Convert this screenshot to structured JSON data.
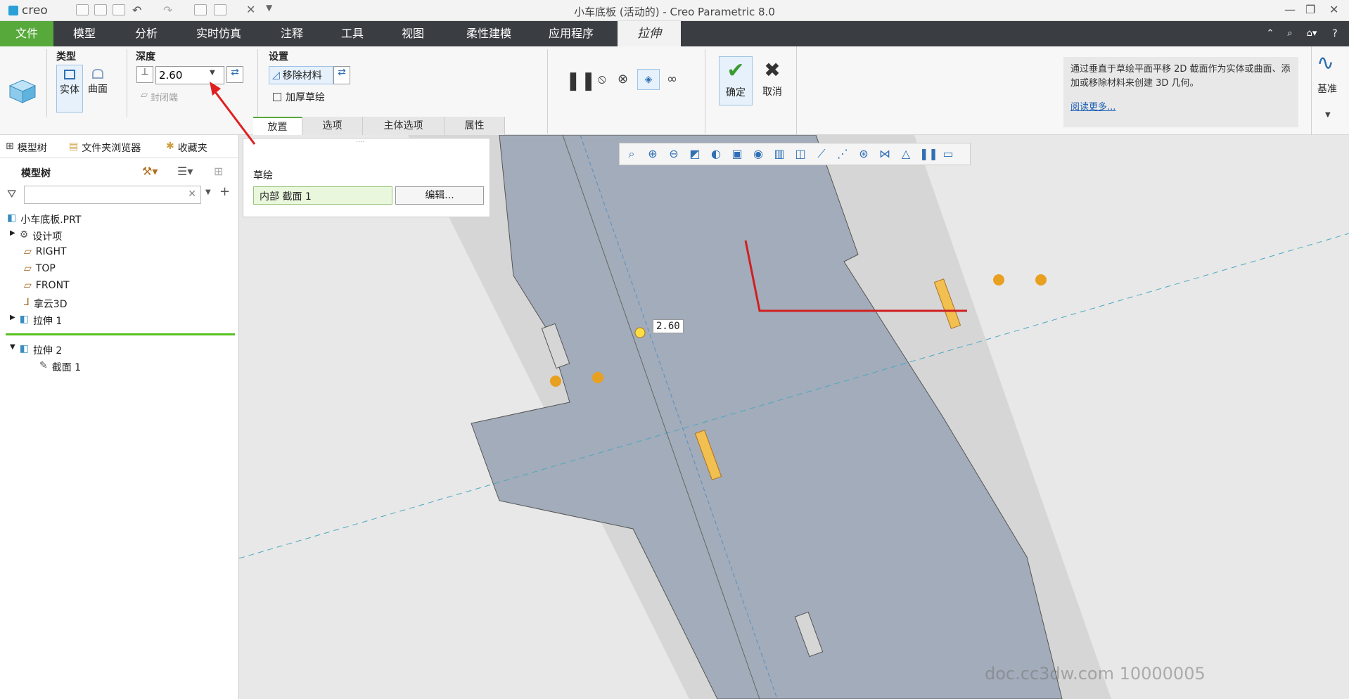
{
  "app": {
    "logo": "creo",
    "title": "小车底板 (活动的) - Creo Parametric 8.0"
  },
  "menu": {
    "file": "文件",
    "items": [
      "模型",
      "分析",
      "实时仿真",
      "注释",
      "工具",
      "视图",
      "柔性建模",
      "应用程序"
    ],
    "active": "拉伸"
  },
  "ribbon": {
    "type_group": "类型",
    "solid": "实体",
    "surface": "曲面",
    "depth_group": "深度",
    "depth_value": "2.60",
    "cap_ends": "封闭端",
    "settings_group": "设置",
    "remove_material": "移除材料",
    "thicken_sketch": "加厚草绘",
    "confirm": "确定",
    "cancel": "取消",
    "tabs": [
      "放置",
      "选项",
      "主体选项",
      "属性"
    ],
    "info_text": "通过垂直于草绘平面平移 2D 截面作为实体或曲面、添加或移除材料来创建 3D 几何。",
    "read_more": "阅读更多...",
    "datum": "基准"
  },
  "left_panel": {
    "tabs": [
      "模型树",
      "文件夹浏览器",
      "收藏夹"
    ],
    "header": "模型树",
    "search_placeholder": "",
    "tree": [
      {
        "label": "小车底板.PRT"
      },
      {
        "label": "设计项"
      },
      {
        "label": "RIGHT"
      },
      {
        "label": "TOP"
      },
      {
        "label": "FRONT"
      },
      {
        "label": "拿云3D"
      },
      {
        "label": "拉伸 1"
      },
      {
        "label": "拉伸 2"
      },
      {
        "label": "截面 1"
      }
    ]
  },
  "popup": {
    "sketch_label": "草绘",
    "sketch_value": "内部 截面 1",
    "edit_button": "编辑..."
  },
  "viewport": {
    "dim_label": "2.60",
    "watermark": "doc.cc3dw.com 10000005"
  },
  "colors": {
    "accent": "#56a93a",
    "menubar": "#3a3d42",
    "part": "#a2acba",
    "selection": "#e6f1fb"
  }
}
